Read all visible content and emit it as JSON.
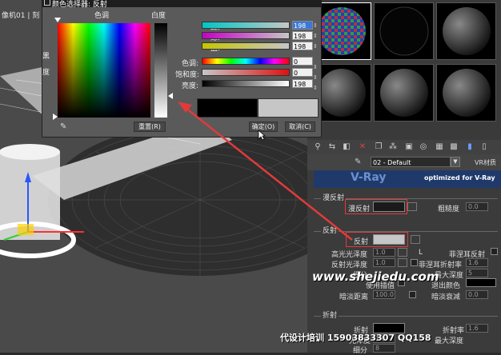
{
  "viewport": {
    "label": "像机01  |  刻"
  },
  "dialog": {
    "title": "颜色选择器: 反射",
    "hue_label": "色调",
    "whiteness_label": "白度",
    "black_label": "黑",
    "degree_label": "度",
    "channels": [
      {
        "label": "红:",
        "value": "198"
      },
      {
        "label": "绿:",
        "value": "198"
      },
      {
        "label": "蓝:",
        "value": "198"
      },
      {
        "label": "色调:",
        "value": "0"
      },
      {
        "label": "饱和度:",
        "value": "0"
      },
      {
        "label": "亮度:",
        "value": "198"
      }
    ],
    "reset_label": "重置(R)",
    "ok_label": "确定(O)",
    "cancel_label": "取消(C)",
    "old_color": "#000000",
    "new_color": "#c6c6c6"
  },
  "material": {
    "name": "02 - Default",
    "renderer": "VR材质",
    "banner": "optimized for V-Ray",
    "diffuse_group": "漫反射",
    "diffuse_label": "漫反射",
    "roughness_label": "粗糙度",
    "roughness_value": "0.0",
    "reflect_group": "反射",
    "reflect_label": "反射",
    "hilight_gloss_label": "高光光泽度",
    "hilight_gloss_value": "1.0",
    "l_label": "L",
    "fresnel_label": "菲涅耳反射",
    "refl_gloss_label": "反射光泽度",
    "refl_gloss_value": "1.0",
    "fresnel_ior_label": "菲涅耳折射率",
    "fresnel_ior_value": "1.6",
    "subdivs_label": "细分",
    "subdivs_value": "8",
    "max_depth_label": "最大深度",
    "max_depth_value": "5",
    "use_interp_label": "使用插值",
    "exit_color_label": "退出颜色",
    "dim_dist_label": "暗淡距离",
    "dim_dist_value": "100.0",
    "dim_falloff_label": "暗淡衰减",
    "dim_falloff_value": "0.0",
    "refract_group": "折射",
    "refract_label": "折射",
    "ior_label": "折射率",
    "ior_value": "1.6",
    "gloss_label": "光泽度",
    "gloss_value": "1.0",
    "max_depth2_label": "最大深度",
    "subdivs2_label": "细分",
    "subdivs2_value": "8"
  },
  "watermark": "www.shejiedu.com",
  "footer": "代设计培训 15903833307 QQ158"
}
